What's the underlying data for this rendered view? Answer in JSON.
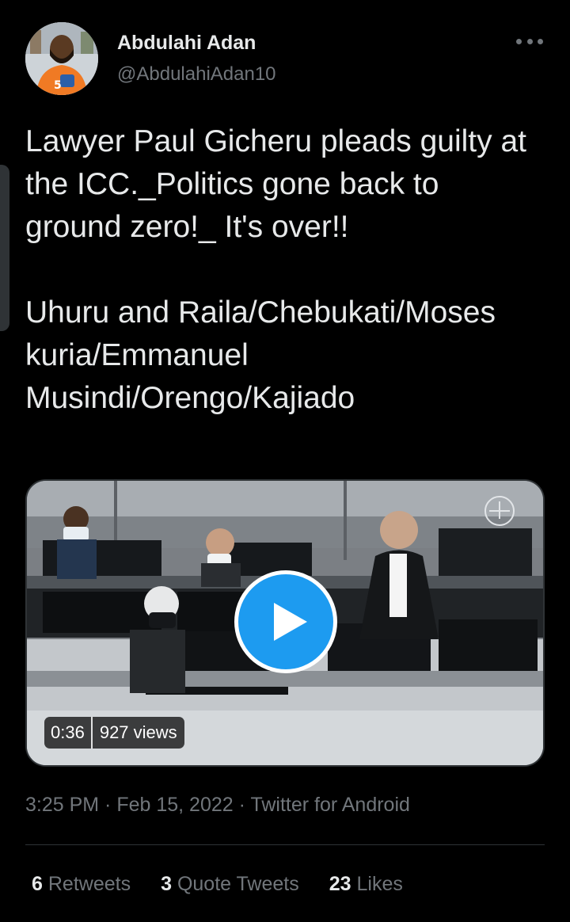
{
  "author": {
    "display_name": "Abdulahi Adan",
    "handle": "@AbdulahiAdan10",
    "avatar_icon": "profile-photo"
  },
  "menu_icon": "more-horizontal-icon",
  "tweet": {
    "text": "Lawyer Paul Gicheru pleads guilty at the ICC._Politics gone back to ground zero!_ It's over!!\n\nUhuru and Raila/Chebukati/Moses kuria/Emmanuel Musindi/Orengo/Kajiado"
  },
  "video": {
    "duration": "0:36",
    "views": "927 views",
    "play_icon": "play-icon",
    "accent_color": "#1d9bf0"
  },
  "meta": {
    "time": "3:25 PM",
    "sep1": " · ",
    "date": "Feb 15, 2022",
    "sep2": " · ",
    "source": "Twitter for Android"
  },
  "stats": {
    "retweets_count": "6",
    "retweets_label": "Retweets",
    "quotes_count": "3",
    "quotes_label": "Quote Tweets",
    "likes_count": "23",
    "likes_label": "Likes"
  }
}
